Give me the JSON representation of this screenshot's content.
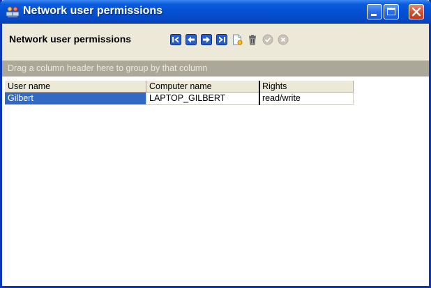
{
  "window": {
    "title": "Network user permissions"
  },
  "toolbar": {
    "title": "Network user permissions",
    "buttons": [
      {
        "name": "first-record-icon"
      },
      {
        "name": "previous-record-icon"
      },
      {
        "name": "next-record-icon"
      },
      {
        "name": "last-record-icon"
      },
      {
        "name": "new-record-icon"
      },
      {
        "name": "delete-record-icon"
      },
      {
        "name": "post-edit-icon"
      },
      {
        "name": "cancel-edit-icon"
      }
    ]
  },
  "group_panel": {
    "text": "Drag a column header here to group by that column"
  },
  "grid": {
    "columns": [
      "User name",
      "Computer name",
      "Rights"
    ],
    "rows": [
      [
        "Gilbert",
        "LAPTOP_GILBERT",
        "read/write"
      ]
    ]
  },
  "colors": {
    "title_bar": "#0450d4",
    "selection": "#316ac5",
    "group_panel": "#aca899",
    "window_face": "#ece9d8"
  }
}
